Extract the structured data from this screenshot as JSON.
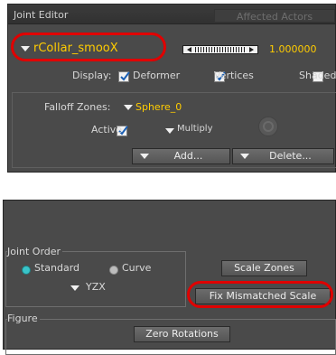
{
  "joint_editor": {
    "title": "Joint Editor",
    "tab_affected_actors": "Affected Actors",
    "joint_name": "rCollar_smooX",
    "scale_value": "1.000000",
    "display_label": "Display:",
    "deformer_label": "Deformer",
    "vertices_label": "Vertices",
    "shaded_label": "Shaded",
    "falloff_zones_label": "Falloff Zones:",
    "falloff_zone_value": "Sphere_0",
    "active_label": "Active",
    "multiply_label": "Multiply",
    "add_label": "Add...",
    "delete_label": "Delete...",
    "deformer_checked": true,
    "vertices_checked": true,
    "shaded_checked": false,
    "active_checked": true
  },
  "lower_panel": {
    "joint_order_label": "Joint Order",
    "standard_label": "Standard",
    "curve_label": "Curve",
    "order_value": "YZX",
    "scale_zones_label": "Scale Zones",
    "fix_mismatched_scale_label": "Fix Mismatched Scale",
    "figure_label": "Figure",
    "zero_rotations_label": "Zero Rotations",
    "selected_order_mode": "Standard"
  },
  "colors": {
    "highlight_ring": "#e00000",
    "joint_name_text": "#ffcc00",
    "panel_bg": "#4a4a4a"
  }
}
